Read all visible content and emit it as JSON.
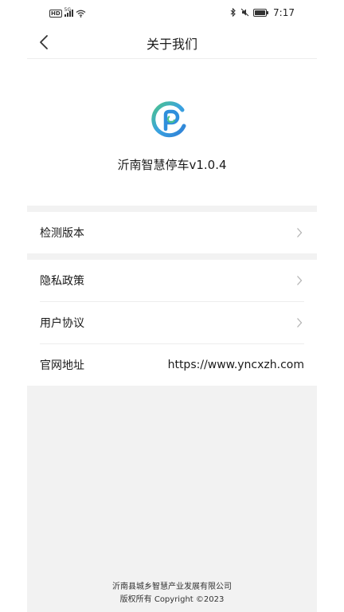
{
  "status_bar": {
    "network_badge": "HD",
    "signal_label": "5G",
    "time": "7:17"
  },
  "nav": {
    "title": "关于我们"
  },
  "app": {
    "name": "沂南智慧停车v1.0.4",
    "logo_colors": [
      "#3aa3e0",
      "#4cc38a",
      "#2f7fd6"
    ]
  },
  "menu": {
    "check_version": "检测版本",
    "privacy_policy": "隐私政策",
    "user_agreement": "用户协议",
    "website_label": "官网地址",
    "website_value": "https://www.yncxzh.com"
  },
  "footer": {
    "company": "沂南县城乡智慧产业发展有限公司",
    "copyright": "版权所有 Copyright ©2023"
  }
}
